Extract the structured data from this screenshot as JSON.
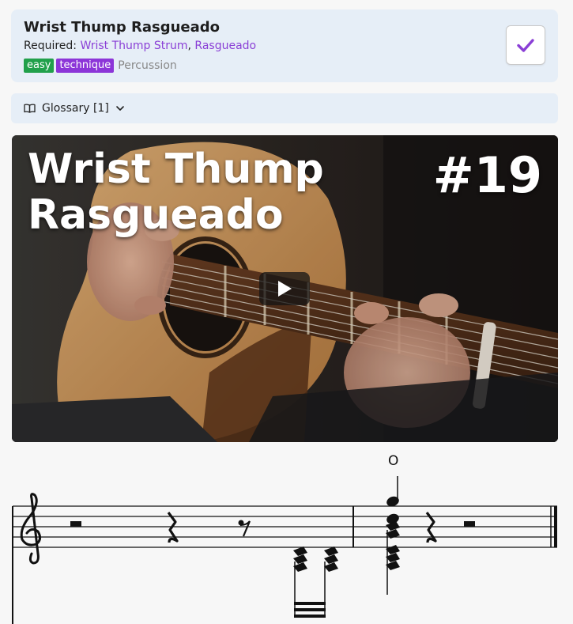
{
  "lesson": {
    "title": "Wrist Thump Rasgueado",
    "required_label": "Required:",
    "required_links": [
      "Wrist Thump Strum",
      "Rasgueado"
    ],
    "required_separator": ",",
    "tags": [
      "easy",
      "technique"
    ],
    "category": "Percussion",
    "completed": true
  },
  "glossary": {
    "label": "Glossary [1]"
  },
  "video": {
    "title_line1": "Wrist Thump",
    "title_line2": "Rasgueado",
    "number": "#19"
  },
  "notation": {
    "string_mark": "O"
  },
  "colors": {
    "accent": "#8a3fd6",
    "easy_tag": "#21a04b",
    "technique_tag": "#8c35d8",
    "card_bg": "#e6eef7"
  },
  "icons": {
    "check": "check-icon",
    "glossary": "book-icon",
    "dropdown": "chevron-down-icon",
    "play": "play-icon"
  }
}
